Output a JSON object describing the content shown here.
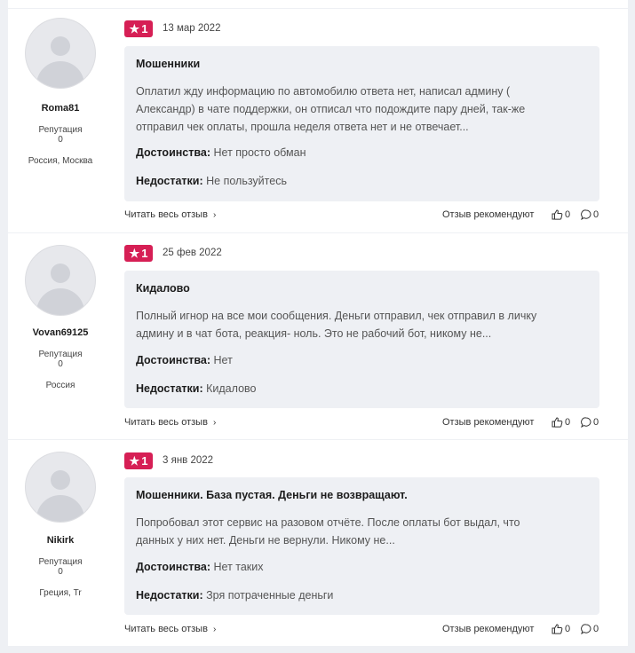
{
  "reviews": [
    {
      "user": {
        "name": "Roma81",
        "reputation_label": "Репутация",
        "reputation": "0",
        "location": "Россия, Москва"
      },
      "rating": "1",
      "date": "13 мар 2022",
      "title": "Мошенники",
      "text": [
        "Оплатил жду информацию по автомобилю ответа нет, написал админу (",
        "Александр) в чате поддержки, он отписал что подождите пару дней, так-же",
        "отправил чек оплаты, прошла неделя ответа нет и не отвечает..."
      ],
      "pros_label": "Достоинства:",
      "pros": "Нет просто обман",
      "cons_label": "Недостатки:",
      "cons": "Не пользуйтесь",
      "read_more": "Читать весь отзыв",
      "recommend": "Отзыв рекомендуют",
      "likes": "0",
      "comments": "0"
    },
    {
      "user": {
        "name": "Vovan69125",
        "reputation_label": "Репутация",
        "reputation": "0",
        "location": "Россия"
      },
      "rating": "1",
      "date": "25 фев 2022",
      "title": "Кидалово",
      "text": [
        "Полный игнор на все мои сообщения. Деньги отправил, чек отправил в личку",
        "админу и в чат бота, реакция- ноль. Это не рабочий бот, никому не..."
      ],
      "pros_label": "Достоинства:",
      "pros": "Нет",
      "cons_label": "Недостатки:",
      "cons": "Кидалово",
      "read_more": "Читать весь отзыв",
      "recommend": "Отзыв рекомендуют",
      "likes": "0",
      "comments": "0"
    },
    {
      "user": {
        "name": "Nikirk",
        "reputation_label": "Репутация",
        "reputation": "0",
        "location": "Греция, Tr"
      },
      "rating": "1",
      "date": "3 янв 2022",
      "title": "Мошенники. База пустая. Деньги не возвращают.",
      "text": [
        "Попробовал этот сервис на разовом отчёте. После оплаты бот выдал, что",
        "данных у них нет. Деньги не вернули. Никому не..."
      ],
      "pros_label": "Достоинства:",
      "pros": "Нет таких",
      "cons_label": "Недостатки:",
      "cons": "Зря потраченные деньги",
      "read_more": "Читать весь отзыв",
      "recommend": "Отзыв рекомендуют",
      "likes": "0",
      "comments": "0"
    }
  ],
  "colors": {
    "badge": "#d61f55",
    "card_bg": "#eef0f4",
    "page_bg": "#eef0f4"
  },
  "icons": {
    "star": "star-icon",
    "chevron": "chevron-right-icon",
    "like": "thumbs-up-icon",
    "comment": "comment-icon"
  }
}
